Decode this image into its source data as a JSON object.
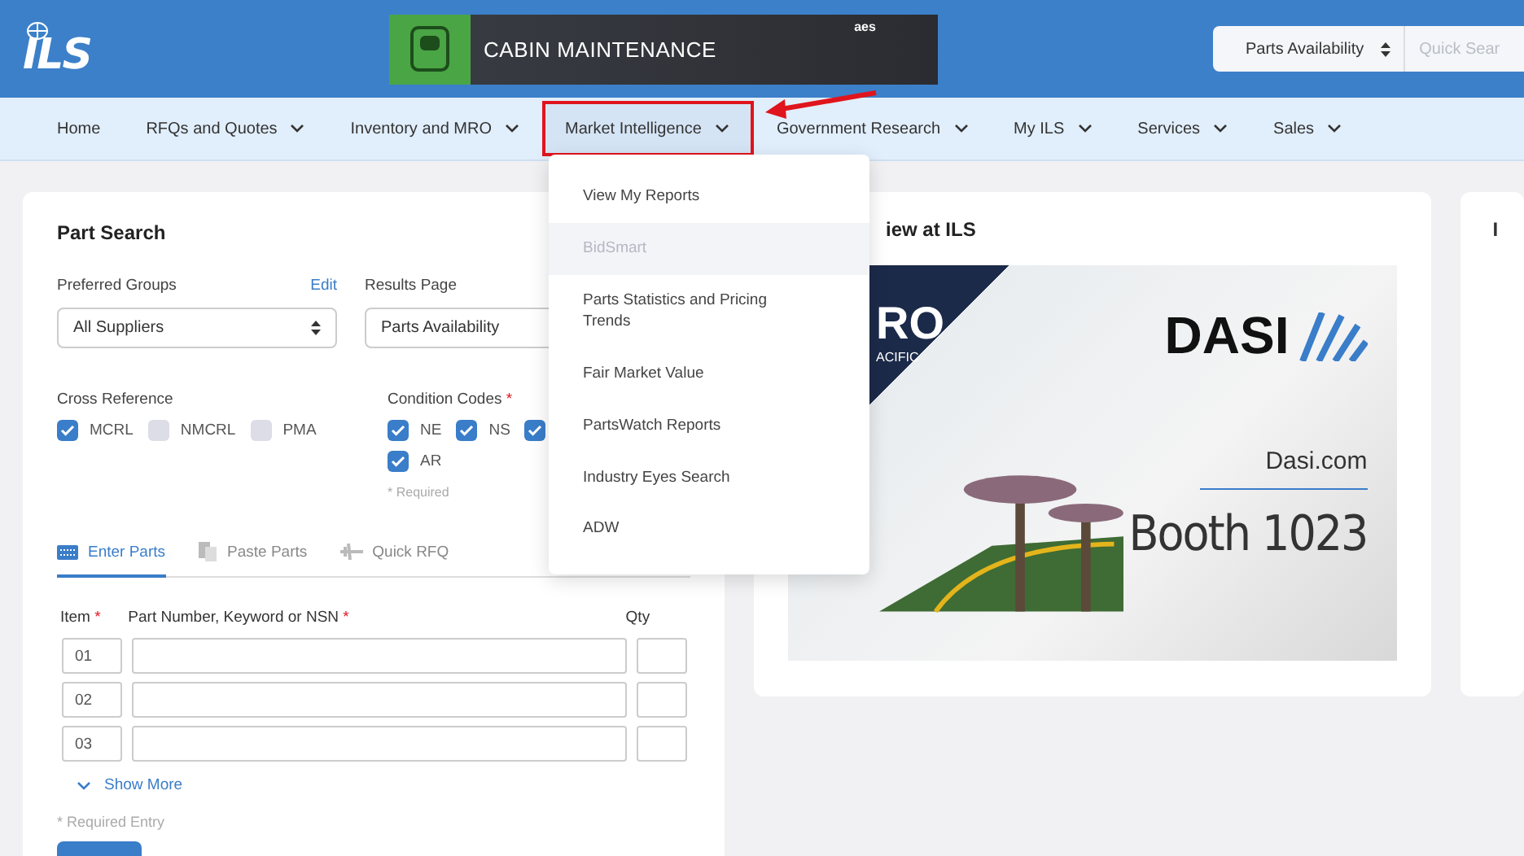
{
  "header": {
    "logo": "ILS",
    "ad_banner": {
      "headline": "CABIN MAINTENANCE",
      "brand": "aes"
    },
    "search_type": "Parts Availability",
    "search_placeholder": "Quick Sear"
  },
  "nav": [
    {
      "label": "Home",
      "has_menu": false,
      "selected": false
    },
    {
      "label": "RFQs and Quotes",
      "has_menu": true,
      "selected": false
    },
    {
      "label": "Inventory and MRO",
      "has_menu": true,
      "selected": false
    },
    {
      "label": "Market Intelligence",
      "has_menu": true,
      "selected": true
    },
    {
      "label": "Government Research",
      "has_menu": true,
      "selected": false
    },
    {
      "label": "My ILS",
      "has_menu": true,
      "selected": false
    },
    {
      "label": "Services",
      "has_menu": true,
      "selected": false
    },
    {
      "label": "Sales",
      "has_menu": true,
      "selected": false
    }
  ],
  "dropdown_menu": [
    {
      "label": "View My Reports",
      "disabled": false
    },
    {
      "label": "BidSmart",
      "disabled": true
    },
    {
      "label": "Parts Statistics and Pricing Trends",
      "disabled": false
    },
    {
      "label": "Fair Market Value",
      "disabled": false
    },
    {
      "label": "PartsWatch Reports",
      "disabled": false
    },
    {
      "label": "Industry Eyes Search",
      "disabled": false
    },
    {
      "label": "ADW",
      "disabled": false
    }
  ],
  "part_search": {
    "title": "Part Search",
    "preferred_groups": {
      "label": "Preferred Groups",
      "edit_link": "Edit",
      "value": "All Suppliers"
    },
    "results_page": {
      "label": "Results Page",
      "value": "Parts Availability"
    },
    "cross_reference": {
      "label": "Cross Reference",
      "options": [
        {
          "label": "MCRL",
          "checked": true
        },
        {
          "label": "NMCRL",
          "checked": false
        },
        {
          "label": "PMA",
          "checked": false
        }
      ]
    },
    "condition_codes": {
      "label": "Condition Codes",
      "required_mark": "*",
      "note": "* Required",
      "options": [
        {
          "label": "NE",
          "checked": true
        },
        {
          "label": "NS",
          "checked": true
        },
        {
          "checked": true
        },
        {
          "label": "AR",
          "checked": true
        }
      ]
    },
    "tabs": [
      {
        "label": "Enter Parts",
        "selected": true
      },
      {
        "label": "Paste Parts",
        "selected": false
      },
      {
        "label": "Quick RFQ",
        "selected": false
      }
    ],
    "columns": [
      {
        "label": "Item",
        "required": true
      },
      {
        "label": "Part Number, Keyword or NSN",
        "required": true
      },
      {
        "label": "Qty",
        "required": false
      }
    ],
    "rows": [
      {
        "item": "01"
      },
      {
        "item": "02"
      },
      {
        "item": "03"
      }
    ],
    "show_more": "Show More",
    "required_entry": "* Required Entry"
  },
  "news_card": {
    "title": "iew at ILS",
    "ad": {
      "event": "RO",
      "event_sub": "ACIFIC",
      "brand": "DASI",
      "site": "Dasi.com",
      "booth": "Booth 1023"
    }
  },
  "side_card": {
    "title": "I"
  }
}
